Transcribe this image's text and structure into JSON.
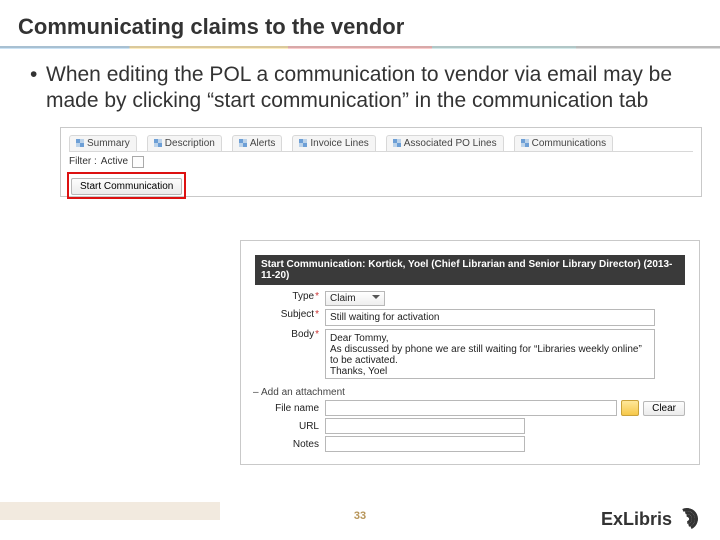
{
  "title": "Communicating claims to the vendor",
  "bullet": "When editing the POL a communication to vendor via email may be made by clicking “start communication” in the communication tab",
  "tabs": [
    "Summary",
    "Description",
    "Alerts",
    "Invoice Lines",
    "Associated PO Lines",
    "Communications"
  ],
  "filter": {
    "label": "Filter :",
    "value": "Active"
  },
  "start_btn": "Start Communication",
  "dialog": {
    "header": "Start Communication: Kortick, Yoel (Chief Librarian and Senior Library Director) (2013-11-20)",
    "type_label": "Type",
    "type_value": "Claim",
    "subject_label": "Subject",
    "subject_value": "Still waiting for activation",
    "body_label": "Body",
    "body_value": "Dear Tommy,\nAs discussed by phone we are still waiting for “Libraries weekly online” to be activated.\nThanks, Yoel",
    "attach_section": "Add an attachment",
    "filename_label": "File name",
    "clear_btn": "Clear",
    "url_label": "URL",
    "notes_label": "Notes"
  },
  "page_number": "33",
  "logo_text": "ExLibris"
}
